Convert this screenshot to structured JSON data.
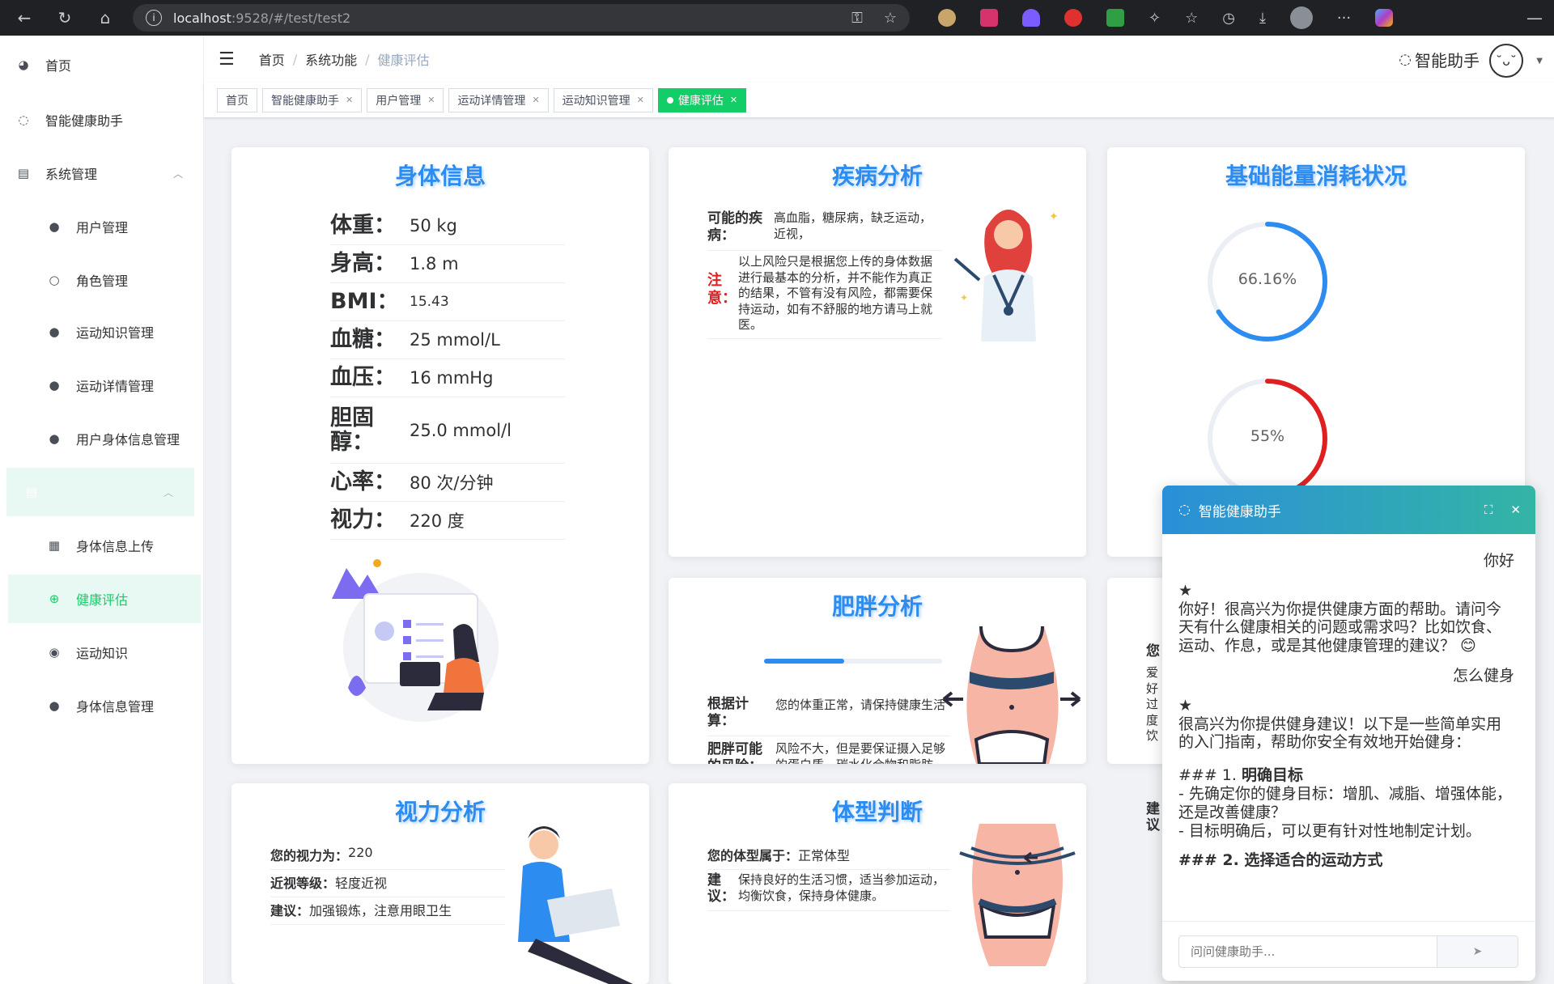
{
  "browser": {
    "url_host": "localhost",
    "url_path": ":9528/#/test/test2"
  },
  "sidebar": {
    "items": [
      {
        "label": "首页",
        "icon": "dashboard-icon"
      },
      {
        "label": "智能健康助手",
        "icon": "chat-icon"
      },
      {
        "label": "系统管理",
        "icon": "clipboard-icon"
      },
      {
        "label": "用户管理",
        "icon": "user-icon"
      },
      {
        "label": "角色管理",
        "icon": "user-outline-icon"
      },
      {
        "label": "运动知识管理",
        "icon": "user-icon"
      },
      {
        "label": "运动详情管理",
        "icon": "user-icon"
      },
      {
        "label": "用户身体信息管理",
        "icon": "user-icon"
      },
      {
        "label": "身体信息上传",
        "icon": "document-icon"
      },
      {
        "label": "健康评估",
        "icon": "health-icon"
      },
      {
        "label": "运动知识",
        "icon": "bulb-icon"
      },
      {
        "label": "身体信息管理",
        "icon": "user-icon"
      }
    ]
  },
  "header": {
    "breadcrumb": [
      "首页",
      "系统功能",
      "健康评估"
    ],
    "assistant_label": "智能助手"
  },
  "tags": [
    {
      "label": "首页",
      "closable": false,
      "active": false
    },
    {
      "label": "智能健康助手",
      "closable": true,
      "active": false
    },
    {
      "label": "用户管理",
      "closable": true,
      "active": false
    },
    {
      "label": "运动详情管理",
      "closable": true,
      "active": false
    },
    {
      "label": "运动知识管理",
      "closable": true,
      "active": false
    },
    {
      "label": "健康评估",
      "closable": true,
      "active": true
    }
  ],
  "body_info": {
    "title": "身体信息",
    "rows": [
      {
        "label": "体重：",
        "value": "50 kg"
      },
      {
        "label": "身高：",
        "value": "1.8 m"
      },
      {
        "label": "BMI：",
        "value": "15.43"
      },
      {
        "label": "血糖：",
        "value": "25 mmol/L"
      },
      {
        "label": "血压：",
        "value": "16 mmHg"
      },
      {
        "label": "胆固醇：",
        "value": "25.0 mmol/l"
      },
      {
        "label": "心率：",
        "value": "80 次/分钟"
      },
      {
        "label": "视力：",
        "value": "220 度"
      }
    ]
  },
  "disease": {
    "title": "疾病分析",
    "possible_label": "可能的疾病：",
    "possible_value": "高血脂，糖尿病，缺乏运动，近视，",
    "note_label": "注意：",
    "note_value": "以上风险只是根据您上传的身体数据进行最基本的分析，并不能作为真正的结果，不管有没有风险，都需要保持运动，如有不舒服的地方请马上就医。"
  },
  "energy": {
    "title": "基础能量消耗状况",
    "gauge1": {
      "value": 0.6616,
      "label": "66.16%",
      "color": "#2d8cf0"
    },
    "gauge2": {
      "value": 0.55,
      "label": "55%",
      "color": "#e02020"
    }
  },
  "obesity": {
    "title": "肥胖分析",
    "progress": 0.45,
    "calc_label": "根据计算：",
    "calc_value": "您的体重正常，请保持健康生活",
    "risk_label": "肥胖可能的风险：",
    "risk_value": "风险不大，但是要保证摄入足够的蛋白质、碳水化合物和脂肪"
  },
  "hidden_card": {
    "text1": "您",
    "text2": "爱好过度饮",
    "text3": "建议"
  },
  "vision": {
    "title": "视力分析",
    "rows": [
      {
        "label": "您的视力为：",
        "value": "220"
      },
      {
        "label": "近视等级：",
        "value": "轻度近视"
      },
      {
        "label": "建议：",
        "value": "加强锻炼，注意用眼卫生"
      }
    ]
  },
  "body_type": {
    "title": "体型判断",
    "type_label": "您的体型属于：",
    "type_value": "正常体型",
    "advice_label": "建议：",
    "advice_value": "保持良好的生活习惯，适当参加运动，均衡饮食，保持身体健康。"
  },
  "chat": {
    "title": "智能健康助手",
    "messages": [
      {
        "role": "user",
        "text": "你好"
      },
      {
        "role": "bot",
        "text": "你好！很高兴为你提供健康方面的帮助。请问今天有什么健康相关的问题或需求吗？比如饮食、运动、作息，或是其他健康管理的建议？ 😊"
      },
      {
        "role": "user",
        "text": "怎么健身"
      },
      {
        "role": "bot",
        "text": "很高兴为你提供健身建议！以下是一些简单实用的入门指南，帮助你安全有效地开始健身："
      }
    ],
    "section1_prefix": "### 1. ",
    "section1_title": "明确目标",
    "bullet1": "- 先确定你的健身目标：增肌、减脂、增强体能，还是改善健康？",
    "bullet2": "- 目标明确后，可以更有针对性地制定计划。",
    "section2": "### 2. 选择适合的运动方式",
    "input_placeholder": "问问健康助手..."
  }
}
